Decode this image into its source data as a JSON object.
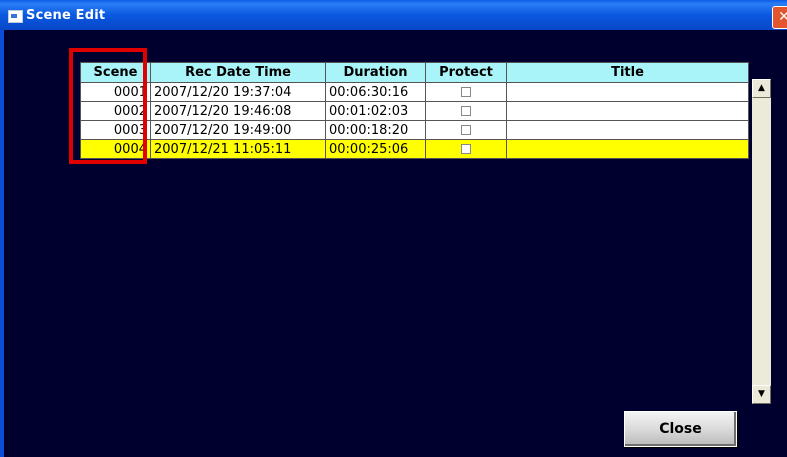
{
  "window": {
    "title": "Scene Edit",
    "close_glyph": "✕"
  },
  "grid": {
    "headers": [
      "Scene",
      "Rec Date Time",
      "Duration",
      "Protect",
      "Title"
    ],
    "rows": [
      {
        "scene": "0001",
        "rec_date_time": "2007/12/20 19:37:04",
        "duration": "00:06:30:16",
        "protect": false,
        "title": "",
        "selected": false
      },
      {
        "scene": "0002",
        "rec_date_time": "2007/12/20 19:46:08",
        "duration": "00:01:02:03",
        "protect": false,
        "title": "",
        "selected": false
      },
      {
        "scene": "0003",
        "rec_date_time": "2007/12/20 19:49:00",
        "duration": "00:00:18:20",
        "protect": false,
        "title": "",
        "selected": false
      },
      {
        "scene": "0004",
        "rec_date_time": "2007/12/21 11:05:11",
        "duration": "00:00:25:06",
        "protect": false,
        "title": "",
        "selected": true
      }
    ]
  },
  "scrollbar": {
    "up_glyph": "▲",
    "down_glyph": "▼"
  },
  "buttons": {
    "close_label": "Close"
  },
  "colors": {
    "background": "#00002e",
    "header_bg": "#a8f4f8",
    "selected_row": "#ffff00",
    "highlight_box": "#e00000",
    "titlebar": "#0a58e0"
  }
}
